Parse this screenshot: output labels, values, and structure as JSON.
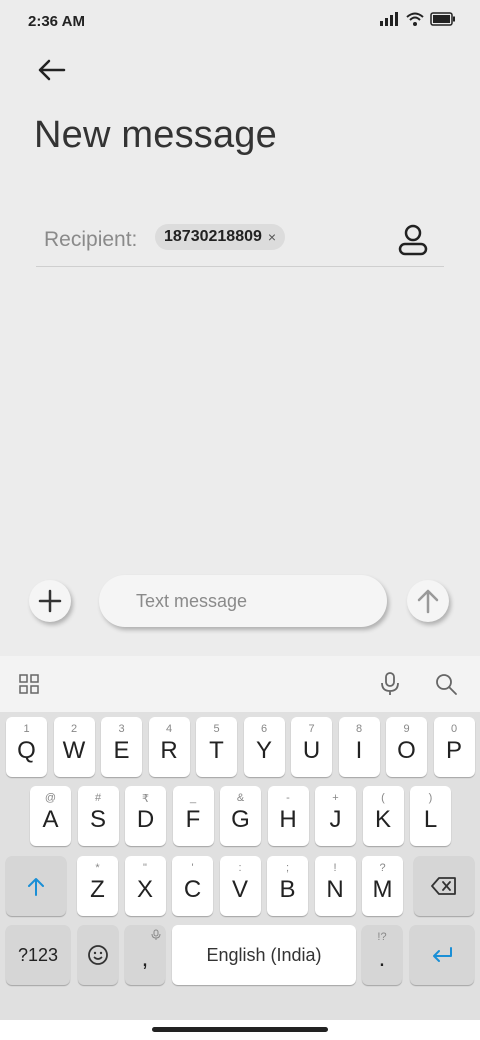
{
  "status_bar": {
    "time": "2:36 AM"
  },
  "header": {
    "title": "New message"
  },
  "recipient": {
    "label": "Recipient:",
    "chip": "18730218809",
    "chip_remove": "×"
  },
  "composer": {
    "placeholder": "Text message"
  },
  "keyboard": {
    "row1": [
      {
        "main": "Q",
        "hint": "1"
      },
      {
        "main": "W",
        "hint": "2"
      },
      {
        "main": "E",
        "hint": "3"
      },
      {
        "main": "R",
        "hint": "4"
      },
      {
        "main": "T",
        "hint": "5"
      },
      {
        "main": "Y",
        "hint": "6"
      },
      {
        "main": "U",
        "hint": "7"
      },
      {
        "main": "I",
        "hint": "8"
      },
      {
        "main": "O",
        "hint": "9"
      },
      {
        "main": "P",
        "hint": "0"
      }
    ],
    "row2": [
      {
        "main": "A",
        "hint": "@"
      },
      {
        "main": "S",
        "hint": "#"
      },
      {
        "main": "D",
        "hint": "₹"
      },
      {
        "main": "F",
        "hint": "_"
      },
      {
        "main": "G",
        "hint": "&"
      },
      {
        "main": "H",
        "hint": "-"
      },
      {
        "main": "J",
        "hint": "+"
      },
      {
        "main": "K",
        "hint": "("
      },
      {
        "main": "L",
        "hint": ")"
      }
    ],
    "row3": [
      {
        "main": "Z",
        "hint": "*"
      },
      {
        "main": "X",
        "hint": "\""
      },
      {
        "main": "C",
        "hint": "'"
      },
      {
        "main": "V",
        "hint": ":"
      },
      {
        "main": "B",
        "hint": ";"
      },
      {
        "main": "N",
        "hint": "!"
      },
      {
        "main": "M",
        "hint": "?"
      }
    ],
    "symbols_key": "?123",
    "comma": ",",
    "space_label": "English (India)",
    "period": ".",
    "period_hint": "!?"
  }
}
